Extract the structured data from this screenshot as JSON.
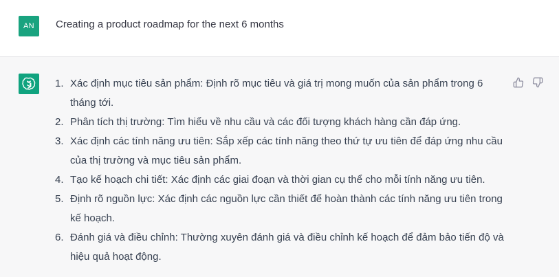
{
  "user_message": {
    "avatar_initials": "AN",
    "text": "Creating a product roadmap for the next 6 months"
  },
  "assistant_message": {
    "items": [
      {
        "num": "1.",
        "text": "Xác định mục tiêu sản phẩm: Định rõ mục tiêu và giá trị mong muốn của sản phẩm trong 6 tháng tới."
      },
      {
        "num": "2.",
        "text": "Phân tích thị trường: Tìm hiểu về nhu cầu và các đối tượng khách hàng cần đáp ứng."
      },
      {
        "num": "3.",
        "text": "Xác định các tính năng ưu tiên: Sắp xếp các tính năng theo thứ tự ưu tiên để đáp ứng nhu cầu của thị trường và mục tiêu sản phẩm."
      },
      {
        "num": "4.",
        "text": "Tạo kế hoạch chi tiết: Xác định các giai đoạn và thời gian cụ thể cho mỗi tính năng ưu tiên."
      },
      {
        "num": "5.",
        "text": "Định rõ nguồn lực: Xác định các nguồn lực cần thiết để hoàn thành các tính năng ưu tiên trong kế hoạch."
      },
      {
        "num": "6.",
        "text": "Đánh giá và điều chỉnh: Thường xuyên đánh giá và điều chỉnh kế hoạch để đảm bảo tiến độ và hiệu quả hoạt động."
      }
    ],
    "icons": {
      "avatar": "openai-logo-icon",
      "like": "thumbs-up-icon",
      "dislike": "thumbs-down-icon"
    }
  },
  "colors": {
    "user_avatar": "#19a37f",
    "bot_avatar": "#10a37f",
    "assistant_bg": "#f7f7f8"
  }
}
